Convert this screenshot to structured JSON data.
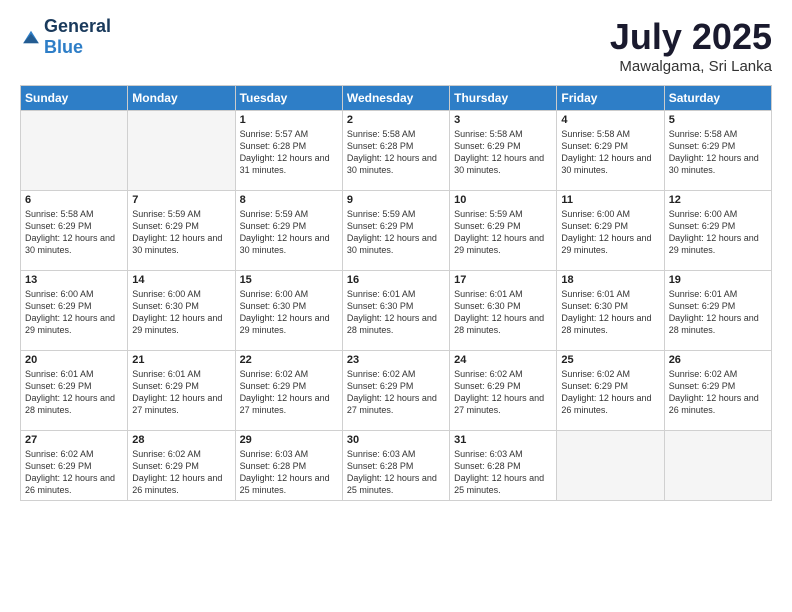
{
  "logo": {
    "general": "General",
    "blue": "Blue"
  },
  "header": {
    "month_year": "July 2025",
    "location": "Mawalgama, Sri Lanka"
  },
  "weekdays": [
    "Sunday",
    "Monday",
    "Tuesday",
    "Wednesday",
    "Thursday",
    "Friday",
    "Saturday"
  ],
  "weeks": [
    [
      {
        "day": "",
        "info": ""
      },
      {
        "day": "",
        "info": ""
      },
      {
        "day": "1",
        "info": "Sunrise: 5:57 AM\nSunset: 6:28 PM\nDaylight: 12 hours and 31 minutes."
      },
      {
        "day": "2",
        "info": "Sunrise: 5:58 AM\nSunset: 6:28 PM\nDaylight: 12 hours and 30 minutes."
      },
      {
        "day": "3",
        "info": "Sunrise: 5:58 AM\nSunset: 6:29 PM\nDaylight: 12 hours and 30 minutes."
      },
      {
        "day": "4",
        "info": "Sunrise: 5:58 AM\nSunset: 6:29 PM\nDaylight: 12 hours and 30 minutes."
      },
      {
        "day": "5",
        "info": "Sunrise: 5:58 AM\nSunset: 6:29 PM\nDaylight: 12 hours and 30 minutes."
      }
    ],
    [
      {
        "day": "6",
        "info": "Sunrise: 5:58 AM\nSunset: 6:29 PM\nDaylight: 12 hours and 30 minutes."
      },
      {
        "day": "7",
        "info": "Sunrise: 5:59 AM\nSunset: 6:29 PM\nDaylight: 12 hours and 30 minutes."
      },
      {
        "day": "8",
        "info": "Sunrise: 5:59 AM\nSunset: 6:29 PM\nDaylight: 12 hours and 30 minutes."
      },
      {
        "day": "9",
        "info": "Sunrise: 5:59 AM\nSunset: 6:29 PM\nDaylight: 12 hours and 30 minutes."
      },
      {
        "day": "10",
        "info": "Sunrise: 5:59 AM\nSunset: 6:29 PM\nDaylight: 12 hours and 29 minutes."
      },
      {
        "day": "11",
        "info": "Sunrise: 6:00 AM\nSunset: 6:29 PM\nDaylight: 12 hours and 29 minutes."
      },
      {
        "day": "12",
        "info": "Sunrise: 6:00 AM\nSunset: 6:29 PM\nDaylight: 12 hours and 29 minutes."
      }
    ],
    [
      {
        "day": "13",
        "info": "Sunrise: 6:00 AM\nSunset: 6:29 PM\nDaylight: 12 hours and 29 minutes."
      },
      {
        "day": "14",
        "info": "Sunrise: 6:00 AM\nSunset: 6:30 PM\nDaylight: 12 hours and 29 minutes."
      },
      {
        "day": "15",
        "info": "Sunrise: 6:00 AM\nSunset: 6:30 PM\nDaylight: 12 hours and 29 minutes."
      },
      {
        "day": "16",
        "info": "Sunrise: 6:01 AM\nSunset: 6:30 PM\nDaylight: 12 hours and 28 minutes."
      },
      {
        "day": "17",
        "info": "Sunrise: 6:01 AM\nSunset: 6:30 PM\nDaylight: 12 hours and 28 minutes."
      },
      {
        "day": "18",
        "info": "Sunrise: 6:01 AM\nSunset: 6:30 PM\nDaylight: 12 hours and 28 minutes."
      },
      {
        "day": "19",
        "info": "Sunrise: 6:01 AM\nSunset: 6:29 PM\nDaylight: 12 hours and 28 minutes."
      }
    ],
    [
      {
        "day": "20",
        "info": "Sunrise: 6:01 AM\nSunset: 6:29 PM\nDaylight: 12 hours and 28 minutes."
      },
      {
        "day": "21",
        "info": "Sunrise: 6:01 AM\nSunset: 6:29 PM\nDaylight: 12 hours and 27 minutes."
      },
      {
        "day": "22",
        "info": "Sunrise: 6:02 AM\nSunset: 6:29 PM\nDaylight: 12 hours and 27 minutes."
      },
      {
        "day": "23",
        "info": "Sunrise: 6:02 AM\nSunset: 6:29 PM\nDaylight: 12 hours and 27 minutes."
      },
      {
        "day": "24",
        "info": "Sunrise: 6:02 AM\nSunset: 6:29 PM\nDaylight: 12 hours and 27 minutes."
      },
      {
        "day": "25",
        "info": "Sunrise: 6:02 AM\nSunset: 6:29 PM\nDaylight: 12 hours and 26 minutes."
      },
      {
        "day": "26",
        "info": "Sunrise: 6:02 AM\nSunset: 6:29 PM\nDaylight: 12 hours and 26 minutes."
      }
    ],
    [
      {
        "day": "27",
        "info": "Sunrise: 6:02 AM\nSunset: 6:29 PM\nDaylight: 12 hours and 26 minutes."
      },
      {
        "day": "28",
        "info": "Sunrise: 6:02 AM\nSunset: 6:29 PM\nDaylight: 12 hours and 26 minutes."
      },
      {
        "day": "29",
        "info": "Sunrise: 6:03 AM\nSunset: 6:28 PM\nDaylight: 12 hours and 25 minutes."
      },
      {
        "day": "30",
        "info": "Sunrise: 6:03 AM\nSunset: 6:28 PM\nDaylight: 12 hours and 25 minutes."
      },
      {
        "day": "31",
        "info": "Sunrise: 6:03 AM\nSunset: 6:28 PM\nDaylight: 12 hours and 25 minutes."
      },
      {
        "day": "",
        "info": ""
      },
      {
        "day": "",
        "info": ""
      }
    ]
  ]
}
